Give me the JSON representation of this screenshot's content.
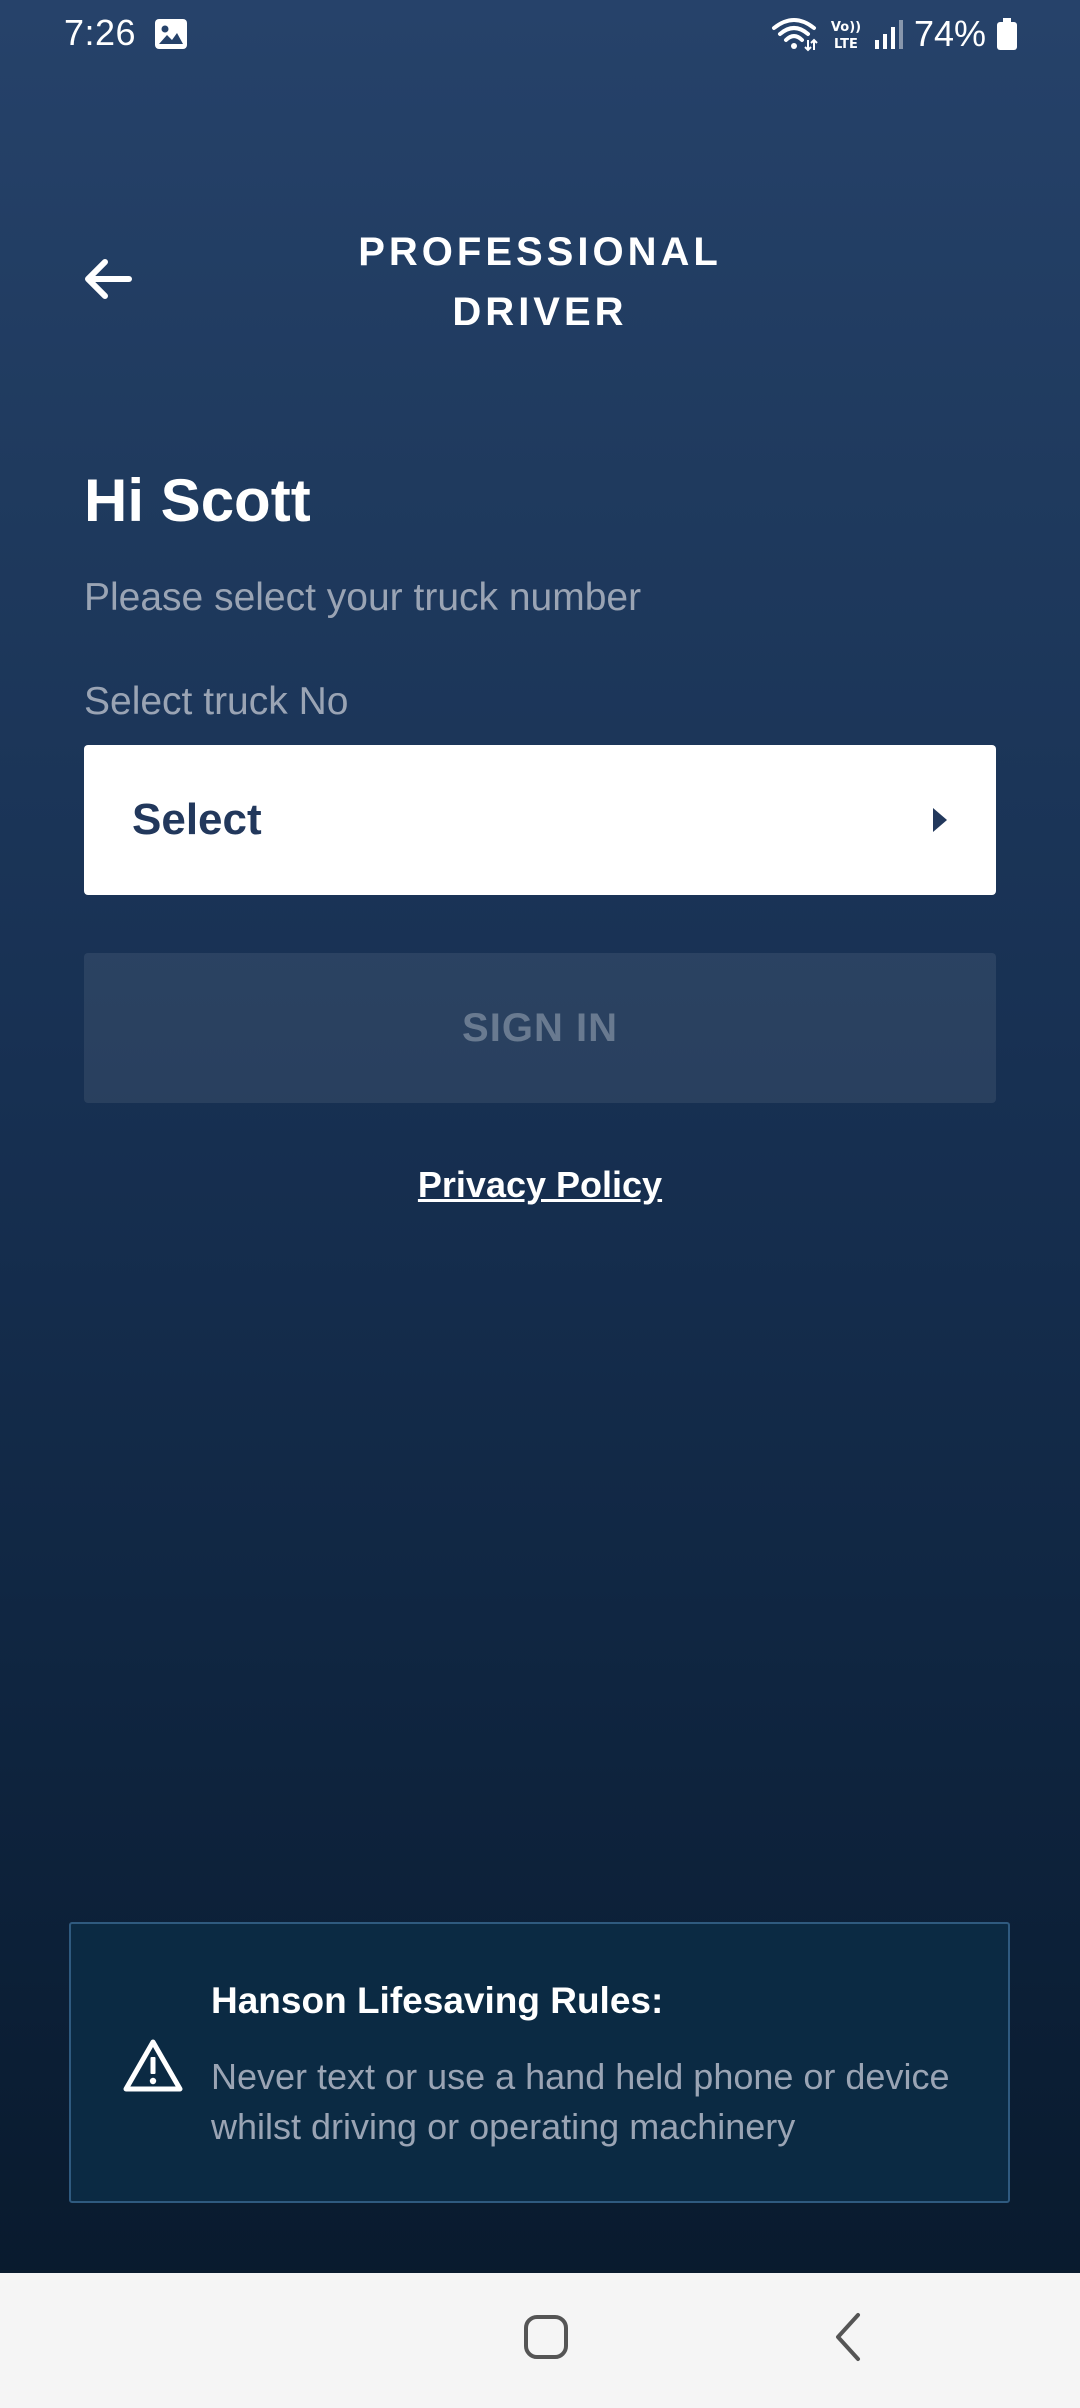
{
  "status_bar": {
    "time": "7:26",
    "battery": "74%",
    "icons": [
      "gallery-icon",
      "wifi-icon",
      "volte-icon",
      "signal-icon",
      "battery-icon"
    ]
  },
  "header": {
    "title_line1": "PROFESSIONAL",
    "title_line2": "DRIVER",
    "back_icon": "back-arrow-icon"
  },
  "main": {
    "greeting": "Hi Scott",
    "subtitle": "Please select your truck number",
    "select_label": "Select truck No",
    "select_value": "Select",
    "sign_in": "SIGN IN",
    "privacy_link": "Privacy Policy"
  },
  "rule_card": {
    "title": "Hanson Lifesaving Rules:",
    "text": "Never text or use a hand held phone or device whilst driving or operating machinery",
    "icon": "warning-icon"
  },
  "nav_bar": {
    "icons": [
      "home-icon",
      "back-icon"
    ]
  },
  "colors": {
    "background_top": "#26426a",
    "background_bottom": "#08192b",
    "select_text": "#22385c",
    "muted_text": "#9aa4b4",
    "disabled_button_text": "#697a90",
    "card_background": "#0b2a43",
    "card_border": "#2f5a7f"
  }
}
